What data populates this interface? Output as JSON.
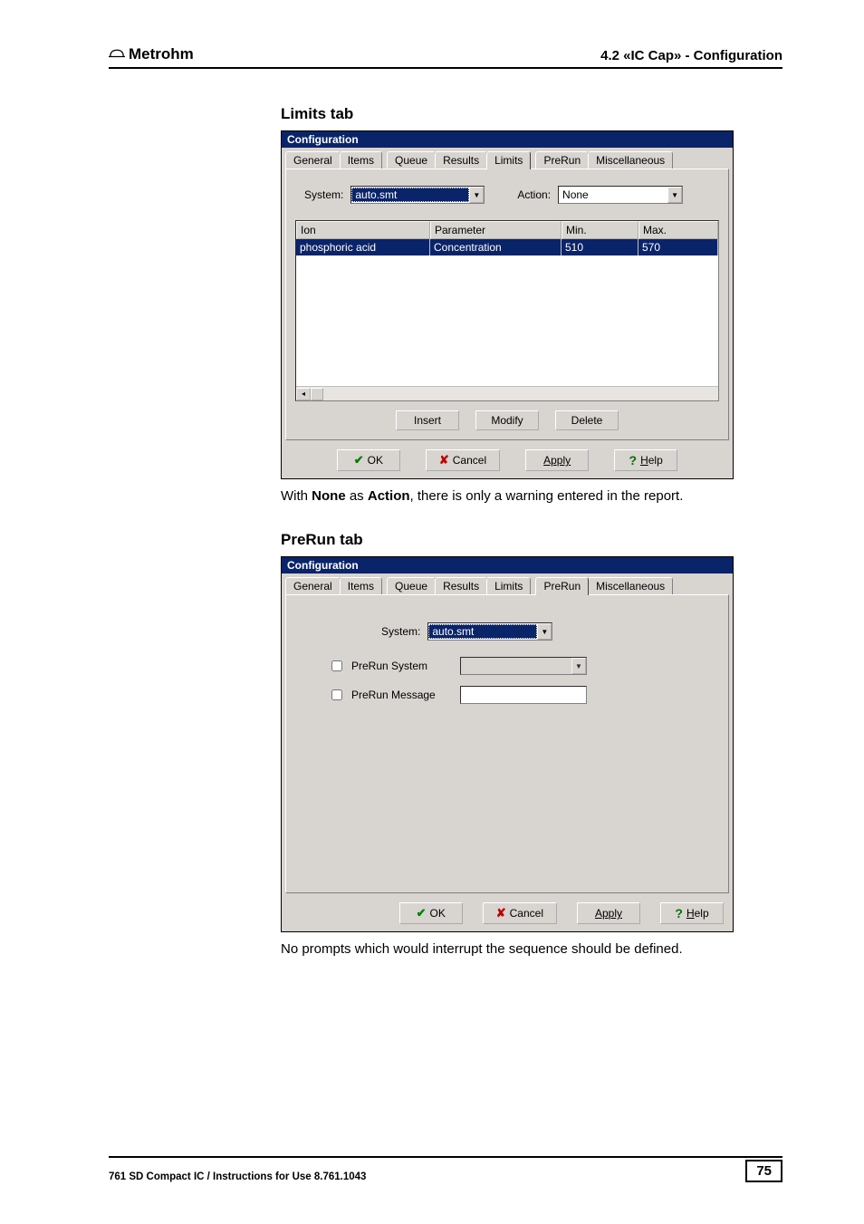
{
  "header": {
    "brand": "Metrohm",
    "breadcrumb": "4.2  «IC Cap» - Configuration"
  },
  "section1": {
    "heading": "Limits tab",
    "dialog": {
      "title": "Configuration",
      "tabs": [
        "General",
        "Items",
        "Queue",
        "Results",
        "Limits",
        "PreRun",
        "Miscellaneous"
      ],
      "active_tab": "Limits",
      "system_label": "System:",
      "system_value": "auto.smt",
      "action_label": "Action:",
      "action_value": "None",
      "columns": {
        "ion": "Ion",
        "parameter": "Parameter",
        "min": "Min.",
        "max": "Max."
      },
      "rows": [
        {
          "ion": "phosphoric acid",
          "parameter": "Concentration",
          "min": "510",
          "max": "570"
        }
      ],
      "buttons_mid": {
        "insert": "Insert",
        "modify": "Modify",
        "delete": "Delete"
      },
      "buttons_bottom": {
        "ok": "OK",
        "cancel": "Cancel",
        "apply": "Apply",
        "help_prefix": "H",
        "help_rest": "elp"
      }
    },
    "caption_pre": "With ",
    "caption_b1": "None",
    "caption_mid": " as ",
    "caption_b2": "Action",
    "caption_post": ", there is only a warning entered in the report."
  },
  "section2": {
    "heading": "PreRun tab",
    "dialog": {
      "title": "Configuration",
      "tabs": [
        "General",
        "Items",
        "Queue",
        "Results",
        "Limits",
        "PreRun",
        "Miscellaneous"
      ],
      "active_tab": "PreRun",
      "system_label": "System:",
      "system_value": "auto.smt",
      "prerun_system_label": "PreRun System",
      "prerun_message_label": "PreRun Message",
      "buttons_bottom": {
        "ok": "OK",
        "cancel": "Cancel",
        "apply": "Apply",
        "help_prefix": "H",
        "help_rest": "elp"
      }
    },
    "caption": "No prompts which would interrupt the sequence should be defined."
  },
  "footer": {
    "left": "761 SD Compact IC / Instructions for Use  8.761.1043",
    "page": "75"
  }
}
